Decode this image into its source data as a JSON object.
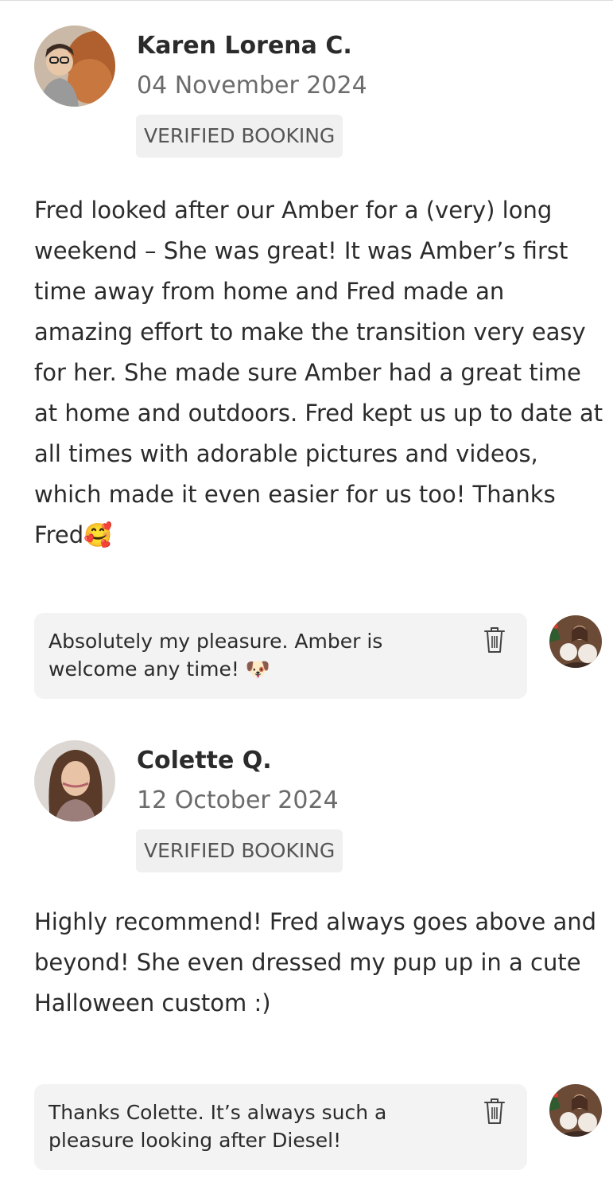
{
  "reviews": [
    {
      "name": "Karen Lorena C.",
      "date": "04 November 2024",
      "badge": "VERIFIED BOOKING",
      "text": "Fred looked after our Amber for a (very) long weekend – She was great! It was Amber’s first time away from home and Fred made an amazing effort to make the transition very easy for her. She made sure Amber had a great time at home and outdoors. Fred kept us up to date at all times with adorable pictures and videos, which made it even easier for us too! Thanks Fred🥰",
      "reply": "Absolutely my pleasure. Amber is welcome any time! 🐶"
    },
    {
      "name": "Colette Q.",
      "date": "12 October 2024",
      "badge": "VERIFIED BOOKING",
      "text": "Highly recommend! Fred always goes above and beyond! She even dressed my pup up in a cute Halloween custom :)",
      "reply": "Thanks Colette. It’s always such a pleasure looking after Diesel!"
    }
  ],
  "icons": {
    "reply_action": "trash-icon"
  }
}
